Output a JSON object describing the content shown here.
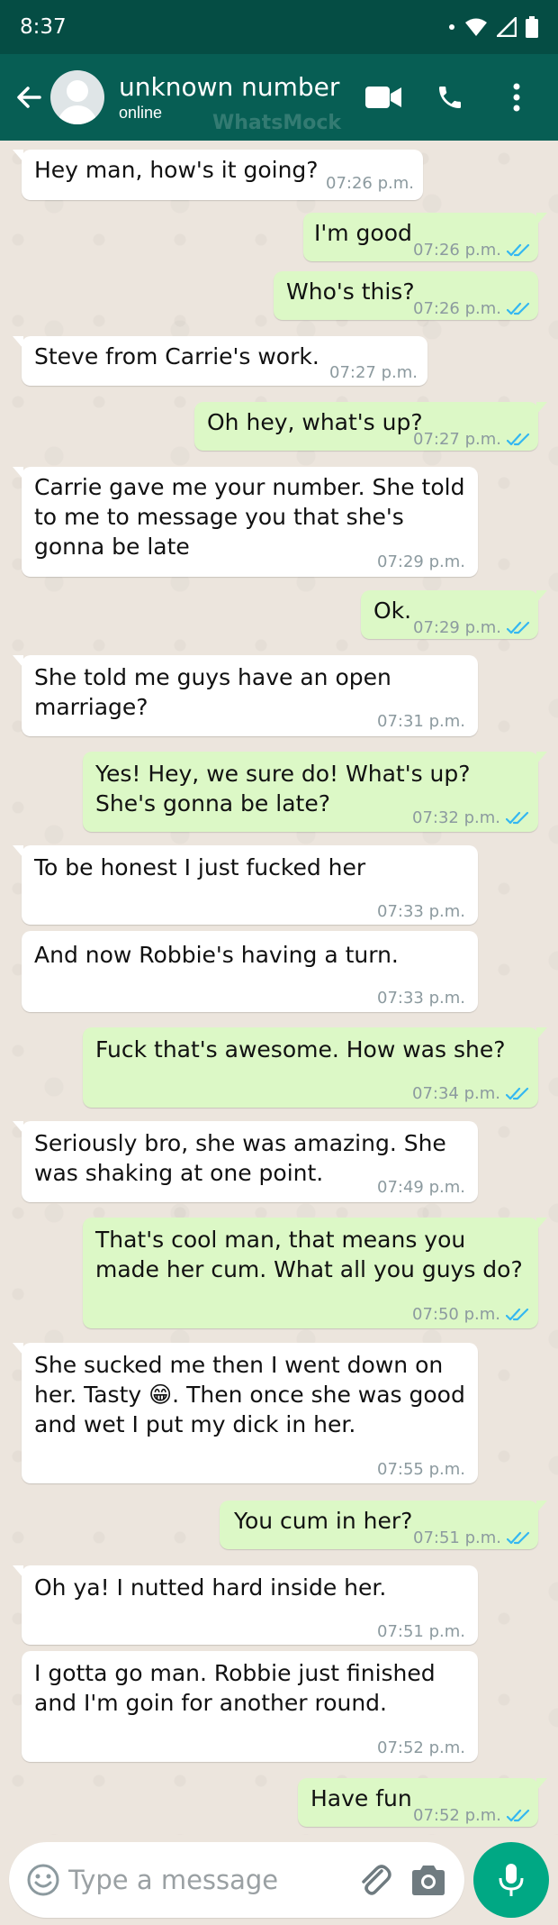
{
  "status_bar": {
    "time": "8:37"
  },
  "header": {
    "contact_name": "unknown number",
    "status": "online",
    "watermark": "WhatsMock",
    "icons": [
      "back-arrow-icon",
      "video-call-icon",
      "phone-call-icon",
      "more-options-icon"
    ]
  },
  "messages": [
    {
      "dir": "in",
      "text": "Hey man, how's it going?",
      "time": "07:26 p.m."
    },
    {
      "dir": "out",
      "text": "I'm good",
      "time": "07:26 p.m.",
      "read": true
    },
    {
      "dir": "out",
      "text": "Who's this?",
      "time": "07:26 p.m.",
      "read": true
    },
    {
      "dir": "in",
      "text": "Steve from Carrie's work.",
      "time": "07:27 p.m."
    },
    {
      "dir": "out",
      "text": "Oh hey, what's up?",
      "time": "07:27 p.m.",
      "read": true
    },
    {
      "dir": "in",
      "text": "Carrie gave me your number.  She told to me to message you that she's gonna be late",
      "time": "07:29 p.m."
    },
    {
      "dir": "out",
      "text": "Ok.",
      "time": "07:29 p.m.",
      "read": true
    },
    {
      "dir": "in",
      "text": "She told me guys have an open marriage?",
      "time": "07:31 p.m."
    },
    {
      "dir": "out",
      "text": "Yes!  Hey, we sure do! What's up? She's gonna be late?",
      "time": "07:32 p.m.",
      "read": true
    },
    {
      "dir": "in",
      "text": "To be honest I just fucked her",
      "time": "07:33 p.m."
    },
    {
      "dir": "in",
      "text": "And now Robbie's having a turn.",
      "time": "07:33 p.m."
    },
    {
      "dir": "out",
      "text": "Fuck that's awesome.  How was she?",
      "time": "07:34 p.m.",
      "read": true
    },
    {
      "dir": "in",
      "text": "Seriously bro, she was amazing.  She was shaking at one point.",
      "time": "07:49 p.m."
    },
    {
      "dir": "out",
      "text": "That's cool man, that means you made her cum.  What all you guys do?",
      "time": "07:50 p.m.",
      "read": true
    },
    {
      "dir": "in",
      "text": "She sucked me then I went down on her.  Tasty 😁.  Then once she was good and wet I put my dick in her.",
      "time": "07:55 p.m."
    },
    {
      "dir": "out",
      "text": "You cum in her?",
      "time": "07:51 p.m.",
      "read": true
    },
    {
      "dir": "in",
      "text": "Oh ya!  I nutted hard inside her.",
      "time": "07:51 p.m."
    },
    {
      "dir": "in",
      "text": "I gotta go man.  Robbie just finished and I'm goin for another round.",
      "time": "07:52 p.m."
    },
    {
      "dir": "out",
      "text": "Have fun",
      "time": "07:52 p.m.",
      "read": true
    }
  ],
  "composer": {
    "placeholder": "Type a message",
    "icons": [
      "emoji-icon",
      "attach-icon",
      "camera-icon",
      "mic-icon"
    ]
  },
  "colors": {
    "header": "#075e54",
    "status_bar": "#054d44",
    "outgoing_bubble": "#dcf8c6",
    "incoming_bubble": "#ffffff",
    "read_ticks": "#34b7f1",
    "mic_button": "#00a884"
  }
}
